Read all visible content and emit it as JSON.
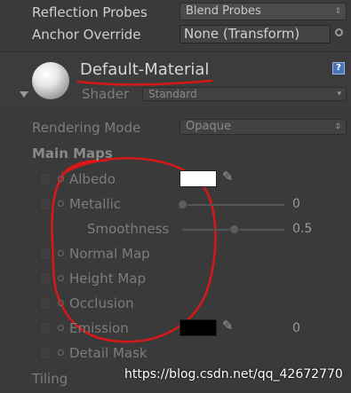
{
  "renderer": {
    "reflection_probes_label": "Reflection Probes",
    "reflection_probes_value": "Blend Probes",
    "anchor_override_label": "Anchor Override",
    "anchor_override_value": "None (Transform)"
  },
  "material": {
    "name": "Default-Material",
    "shader_label": "Shader",
    "shader_value": "Standard",
    "help_icon": "?"
  },
  "properties": {
    "rendering_mode_label": "Rendering Mode",
    "rendering_mode_value": "Opaque",
    "main_maps_label": "Main Maps",
    "albedo_label": "Albedo",
    "metallic_label": "Metallic",
    "metallic_value": "0",
    "metallic_level": 0,
    "smoothness_label": "Smoothness",
    "smoothness_value": "0.5",
    "smoothness_level": 0.5,
    "normal_map_label": "Normal Map",
    "height_map_label": "Height Map",
    "occlusion_label": "Occlusion",
    "emission_label": "Emission",
    "emission_value": "0",
    "detail_mask_label": "Detail Mask",
    "tiling_label": "Tiling"
  },
  "colors": {
    "albedo": "#ffffff",
    "emission": "#000000",
    "annotation": "#d81818"
  },
  "watermark": "https://blog.csdn.net/qq_42672770"
}
